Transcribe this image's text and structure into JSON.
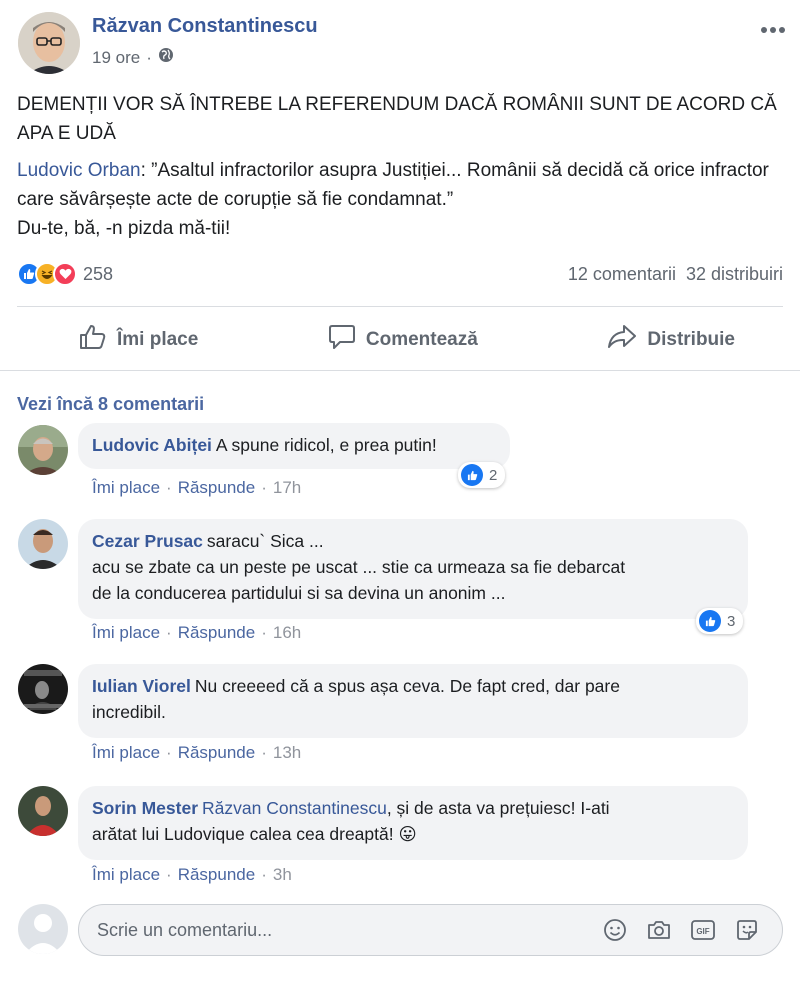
{
  "post": {
    "author": "Răzvan Constantinescu",
    "time": "19 ore",
    "separator": "·",
    "more_icon": "more-horizontal-icon",
    "headline": "DEMENȚII VOR SĂ ÎNTREBE LA REFERENDUM DACĂ ROMÂNII SUNT DE ACORD CĂ APA E UDĂ",
    "quote_author": "Ludovic Orban",
    "quote_text": ": ”Asaltul infractorilor asupra Justiției... Românii să decidă că orice infractor care săvârșește acte de corupție să fie condamnat.”",
    "reply_line": "Du-te, bă, -n pizda mă-tii!",
    "reaction_count": "258",
    "comments_count": "12 comentarii",
    "shares_count": "32 distribuiri"
  },
  "actions": {
    "like": "Îmi place",
    "comment": "Comentează",
    "share": "Distribuie"
  },
  "comments": {
    "view_more": "Vezi încă 8 comentarii",
    "like_label": "Îmi place",
    "reply_label": "Răspunde",
    "dot": "·",
    "items": [
      {
        "name": "Ludovic Abiței",
        "text": "A spune ridicol, e prea putin!",
        "time": "17h",
        "likes": "2"
      },
      {
        "name": "Cezar Prusac",
        "text": "saracu` Sica ...",
        "text2": "acu se zbate ca un peste pe uscat ... stie ca urmeaza sa fie debarcat",
        "text3": "de la conducerea partidului si sa devina un anonim ...",
        "time": "16h",
        "likes": "3"
      },
      {
        "name": "Iulian Viorel",
        "text": "Nu creeeed că a spus așa ceva. De fapt cred, dar pare",
        "text2": "incredibil.",
        "time": "13h"
      },
      {
        "name": "Sorin Mester",
        "mention": "Răzvan Constantinescu",
        "text": ", și de asta va prețuiesc! I-ati",
        "text2": "arătat lui Ludovique calea cea dreaptă!",
        "emoji": "😛",
        "time": "3h"
      }
    ]
  },
  "composer": {
    "placeholder": "Scrie un comentariu...",
    "gif_label": "GIF"
  },
  "colors": {
    "link": "#385898",
    "like_blue": "#1877f2",
    "haha_yellow": "#f7b125",
    "love_red": "#f33e58",
    "bubble_bg": "#f2f3f5"
  }
}
